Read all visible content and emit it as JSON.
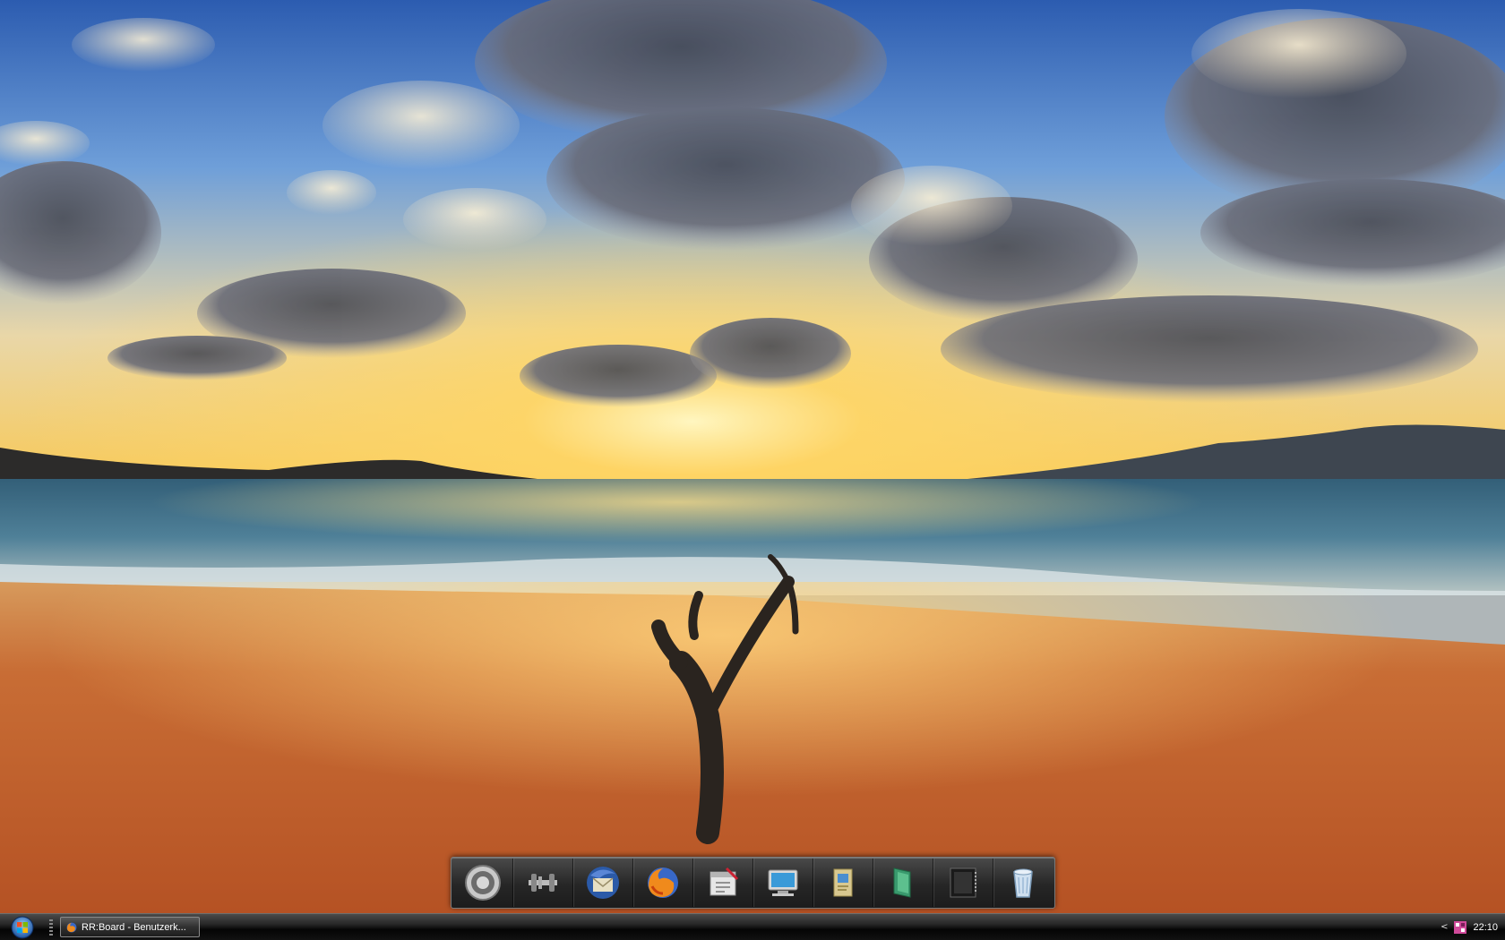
{
  "desktop": {
    "wallpaper_description_colors": {
      "sky_top": "#2f63b8",
      "sun": "#ffe38a",
      "sea": "#2b5a6e",
      "sand": "#c8632c"
    }
  },
  "dock": {
    "items": [
      {
        "icon": "speaker-icon"
      },
      {
        "icon": "system-tools-icon"
      },
      {
        "icon": "thunderbird-icon"
      },
      {
        "icon": "firefox-icon"
      },
      {
        "icon": "text-editor-icon"
      },
      {
        "icon": "my-computer-icon"
      },
      {
        "icon": "documents-icon"
      },
      {
        "icon": "folder-icon"
      },
      {
        "icon": "media-player-icon"
      },
      {
        "icon": "recycle-bin-icon"
      }
    ]
  },
  "taskbar": {
    "start_icon": "windows-logo-icon",
    "task": {
      "icon": "firefox-icon",
      "label": "RR:Board - Benutzerk..."
    },
    "tray": {
      "expand_symbol": "<",
      "clock": "22:10"
    }
  }
}
